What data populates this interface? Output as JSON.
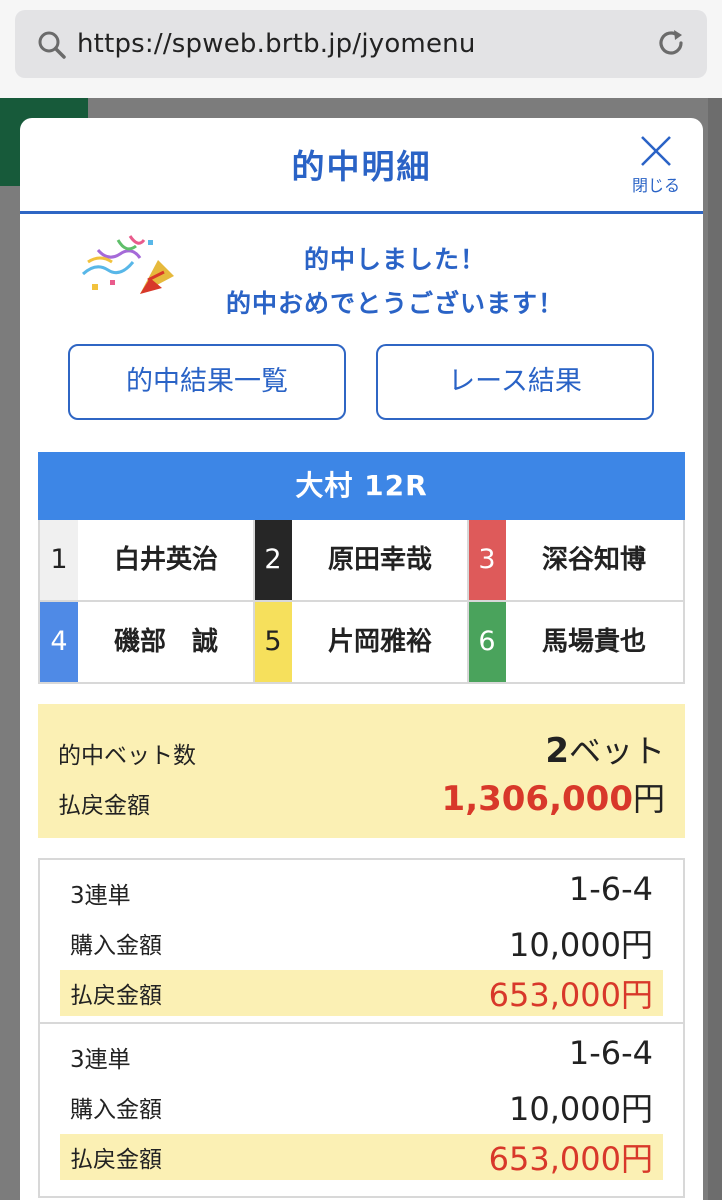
{
  "browser": {
    "url": "https://spweb.brtb.jp/jyomenu"
  },
  "modal": {
    "title": "的中明細",
    "close_label": "閉じる",
    "congrats_line1": "的中しました！",
    "congrats_line2": "的中おめでとうございます！",
    "buttons": {
      "hit_list": "的中結果一覧",
      "race_result": "レース結果"
    }
  },
  "race": {
    "title": "大村 12R",
    "racers": [
      {
        "num": "1",
        "name": "白井英治",
        "bg": "#f0f0f0",
        "fg": "#222222"
      },
      {
        "num": "2",
        "name": "原田幸哉",
        "bg": "#262626",
        "fg": "#ffffff"
      },
      {
        "num": "3",
        "name": "深谷知博",
        "bg": "#de5a5a",
        "fg": "#ffffff"
      },
      {
        "num": "4",
        "name": "磯部　誠",
        "bg": "#4f8ae6",
        "fg": "#ffffff"
      },
      {
        "num": "5",
        "name": "片岡雅裕",
        "bg": "#f6e05c",
        "fg": "#222222"
      },
      {
        "num": "6",
        "name": "馬場貴也",
        "bg": "#4aa35c",
        "fg": "#ffffff"
      }
    ]
  },
  "summary": {
    "bets_label": "的中ベット数",
    "bets_value": "2",
    "bets_unit": "ベット",
    "payout_label": "払戻金額",
    "payout_value": "1,306,000",
    "payout_unit": "円"
  },
  "bets": [
    {
      "type": "3連単",
      "combo": "1-6-4",
      "purchase_label": "購入金額",
      "purchase": "10,000円",
      "payout_label": "払戻金額",
      "payout": "653,000円"
    },
    {
      "type": "3連単",
      "combo": "1-6-4",
      "purchase_label": "購入金額",
      "purchase": "10,000円",
      "payout_label": "払戻金額",
      "payout": "653,000円"
    }
  ]
}
